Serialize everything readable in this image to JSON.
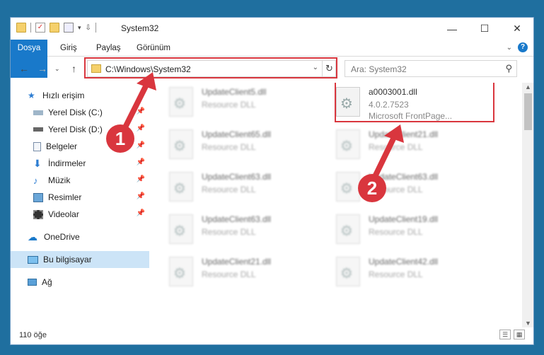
{
  "window": {
    "title": "System32",
    "controls": {
      "minimize": "—",
      "maximize": "☐",
      "close": "✕"
    }
  },
  "ribbon": {
    "tabs": [
      {
        "label": "Dosya"
      },
      {
        "label": "Giriş"
      },
      {
        "label": "Paylaş"
      },
      {
        "label": "Görünüm"
      }
    ],
    "expand_icon": "chevron-down-icon",
    "help_label": "?"
  },
  "nav": {
    "address": "C:\\Windows\\System32",
    "search_placeholder": "Ara: System32"
  },
  "sidebar": {
    "items": [
      {
        "label": "Hızlı erişim",
        "icon": "star-icon",
        "pinned": false
      },
      {
        "label": "Yerel Disk (C:)",
        "icon": "drive-icon",
        "pinned": true
      },
      {
        "label": "Yerel Disk (D:)",
        "icon": "drive-icon",
        "pinned": true
      },
      {
        "label": "Belgeler",
        "icon": "documents-icon",
        "pinned": true
      },
      {
        "label": "İndirmeler",
        "icon": "download-icon",
        "pinned": true
      },
      {
        "label": "Müzik",
        "icon": "music-icon",
        "pinned": true
      },
      {
        "label": "Resimler",
        "icon": "pictures-icon",
        "pinned": true
      },
      {
        "label": "Videolar",
        "icon": "videos-icon",
        "pinned": true
      },
      {
        "label": "OneDrive",
        "icon": "cloud-icon",
        "pinned": false
      },
      {
        "label": "Bu bilgisayar",
        "icon": "computer-icon",
        "pinned": false,
        "selected": true
      },
      {
        "label": "Ağ",
        "icon": "network-icon",
        "pinned": false
      }
    ]
  },
  "files": {
    "highlighted": {
      "name": "a0003001.dll",
      "version": "4.0.2.7523",
      "description": "Microsoft FrontPage..."
    },
    "left_column": [
      {
        "name": "UpdateClient5.dll",
        "type": "Resource DLL"
      },
      {
        "name": "UpdateClient65.dll",
        "type": "Resource DLL"
      },
      {
        "name": "UpdateClient63.dll",
        "type": "Resource DLL"
      },
      {
        "name": "UpdateClient63.dll",
        "type": "Resource DLL"
      },
      {
        "name": "UpdateClient21.dll",
        "type": "Resource DLL"
      }
    ],
    "right_column": [
      {
        "name": "UpdateClient21.dll",
        "type": "Resource DLL"
      },
      {
        "name": "UpdateClient63.dll",
        "type": "Resource DLL"
      },
      {
        "name": "UpdateClient19.dll",
        "type": "Resource DLL"
      },
      {
        "name": "UpdateClient42.dll",
        "type": "Resource DLL"
      }
    ]
  },
  "status": {
    "count": "110 öğe"
  },
  "annotations": [
    {
      "label": "1"
    },
    {
      "label": "2"
    }
  ],
  "colors": {
    "accent": "#1979ca",
    "annotation": "#d9363e",
    "selected": "#cce4f7"
  }
}
